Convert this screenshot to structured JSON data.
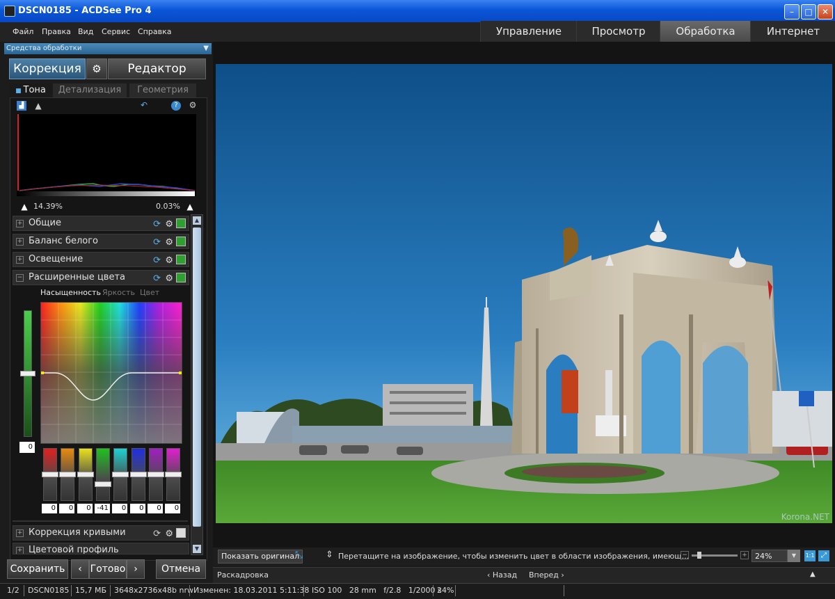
{
  "window": {
    "title": "DSCN0185 - ACDSee Pro 4"
  },
  "menu": [
    "Файл",
    "Правка",
    "Вид",
    "Сервис",
    "Справка"
  ],
  "modes": [
    "Управление",
    "Просмотр",
    "Обработка",
    "Интернет"
  ],
  "active_mode": "Обработка",
  "panel": {
    "header": "Средства обработки",
    "correction_label": "Коррекция",
    "editor_label": "Редактор",
    "tabs": [
      "Тона",
      "Детализация",
      "Геометрия"
    ],
    "histogram": {
      "shadows_clip": "14.39%",
      "highlights_clip": "0.03%"
    },
    "sections": [
      {
        "label": "Общие",
        "enabled": true
      },
      {
        "label": "Баланс белого",
        "enabled": true
      },
      {
        "label": "Освещение",
        "enabled": true
      },
      {
        "label": "Расширенные цвета",
        "enabled": true,
        "expanded": true
      },
      {
        "label": "Коррекция кривыми",
        "enabled": false
      },
      {
        "label": "Цветовой профиль",
        "enabled": false
      }
    ],
    "advanced_color": {
      "modes": [
        "Насыщенность",
        "Яркость",
        "Цвет"
      ],
      "active_mode": "Насыщенность",
      "master_value": "0",
      "channels": [
        {
          "color": "#e02020",
          "value": "0",
          "level": 0.5
        },
        {
          "color": "#e88a10",
          "value": "0",
          "level": 0.5
        },
        {
          "color": "#e8e020",
          "value": "0",
          "level": 0.5
        },
        {
          "color": "#20c020",
          "value": "-41",
          "level": 0.29
        },
        {
          "color": "#20d0d0",
          "value": "0",
          "level": 0.5
        },
        {
          "color": "#2030e0",
          "value": "0",
          "level": 0.5
        },
        {
          "color": "#a020c0",
          "value": "0",
          "level": 0.5
        },
        {
          "color": "#e020d0",
          "value": "0",
          "level": 0.5
        }
      ]
    },
    "save_label": "Сохранить",
    "done_label": "Готово",
    "cancel_label": "Отмена"
  },
  "toolbar": {
    "show_original": "Показать оригинал",
    "hint": "Перетащите на изображение, чтобы изменить цвет в области изображения, имеющ...",
    "zoom": "24%"
  },
  "filmstrip": {
    "label": "Раскадровка",
    "back": "Назад",
    "forward": "Вперед"
  },
  "watermark": "Korona.NET",
  "status": {
    "index": "1/2",
    "name": "DSCN0185",
    "size": "15,7 МБ",
    "dims": "3648x2736x48b nrw",
    "modified": "Изменен: 18.03.2011 5:11:38",
    "exif": "ISO 100   28 mm   f/2.8   1/2000 s",
    "zoom": "24%"
  }
}
